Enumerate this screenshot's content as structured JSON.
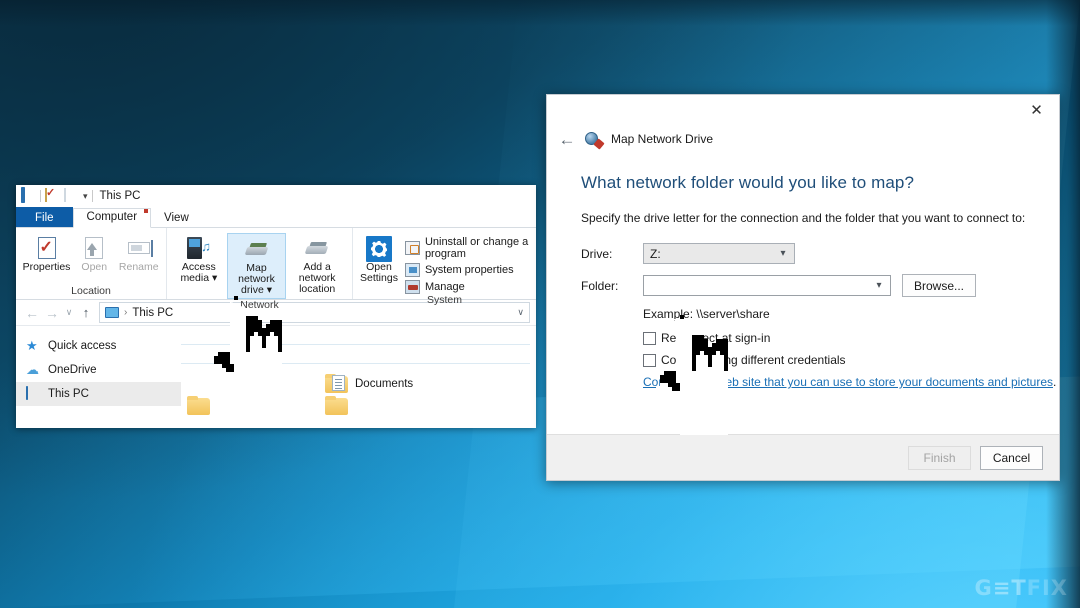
{
  "desktop": {
    "watermark_lead": "G",
    "watermark_mid": "≡T",
    "watermark_tail": "FIX"
  },
  "explorer": {
    "window_title": "This PC",
    "quick_access_icons": [
      "this-pc-icon",
      "properties-icon",
      "blank-icon",
      "dropdown-caret"
    ],
    "tabs": [
      {
        "label": "File",
        "active": false,
        "style": "file"
      },
      {
        "label": "Computer",
        "active": true,
        "style": "normal"
      },
      {
        "label": "View",
        "active": false,
        "style": "normal"
      }
    ],
    "ribbon_groups": [
      {
        "name": "Location",
        "label": "Location",
        "big_buttons": [
          {
            "label": "Properties",
            "icon": "properties-icon",
            "disabled": false,
            "selected": false
          },
          {
            "label": "Open",
            "icon": "open-icon",
            "disabled": true,
            "selected": false
          },
          {
            "label": "Rename",
            "icon": "rename-icon",
            "disabled": true,
            "selected": false
          }
        ]
      },
      {
        "name": "Network",
        "label": "Network",
        "big_buttons": [
          {
            "label": "Access media",
            "icon": "access-media-icon",
            "disabled": false,
            "selected": false,
            "has_caret": true
          },
          {
            "label": "Map network drive",
            "icon": "map-network-drive-icon",
            "disabled": false,
            "selected": true,
            "has_caret": true
          },
          {
            "label": "Add a network location",
            "icon": "add-network-location-icon",
            "disabled": false,
            "selected": false
          }
        ]
      },
      {
        "name": "System",
        "label": "System",
        "big_buttons": [
          {
            "label": "Open Settings",
            "icon": "settings-gear-icon",
            "disabled": false,
            "selected": false
          }
        ],
        "small_items": [
          {
            "label": "Uninstall or change a program",
            "icon": "uninstall-program-icon"
          },
          {
            "label": "System properties",
            "icon": "system-properties-icon"
          },
          {
            "label": "Manage",
            "icon": "manage-icon"
          }
        ]
      }
    ],
    "address_bar": {
      "back_glyph": "←",
      "forward_glyph": "→",
      "recent_glyph": "∨",
      "up_glyph": "↑",
      "path_icon": "this-pc-icon",
      "separator": "›",
      "path_label": "This PC",
      "dropdown_glyph": "∨"
    },
    "nav_pane": [
      {
        "label": "Quick access",
        "icon": "star-icon",
        "selected": false
      },
      {
        "label": "OneDrive",
        "icon": "cloud-icon",
        "selected": false
      },
      {
        "label": "This PC",
        "icon": "this-pc-icon",
        "selected": true
      }
    ],
    "content_items": [
      {
        "label": "Documents",
        "icon": "documents-folder-icon"
      }
    ]
  },
  "dialog": {
    "app_title": "Map Network Drive",
    "app_icon": "map-network-drive-icon",
    "back_glyph": "←",
    "close_glyph": "✕",
    "heading": "What network folder would you like to map?",
    "lead": "Specify the drive letter for the connection and the folder that you want to connect to:",
    "fields": [
      {
        "label": "Drive:",
        "value": "Z:",
        "type": "combobox",
        "name": "drive-select"
      },
      {
        "label": "Folder:",
        "value": "",
        "type": "combobox-editable",
        "name": "folder-combobox"
      }
    ],
    "browse_label": "Browse...",
    "example_text": "Example: \\\\server\\share",
    "checkboxes": [
      {
        "label": "Reconnect at sign-in",
        "checked": false
      },
      {
        "label": "Connect using different credentials",
        "checked": false
      }
    ],
    "link_text": "Connect to a Web site that you can use to store your documents and pictures",
    "link_suffix": ".",
    "footer_buttons": [
      {
        "label": "Finish",
        "disabled": true
      },
      {
        "label": "Cancel",
        "disabled": false
      }
    ]
  }
}
